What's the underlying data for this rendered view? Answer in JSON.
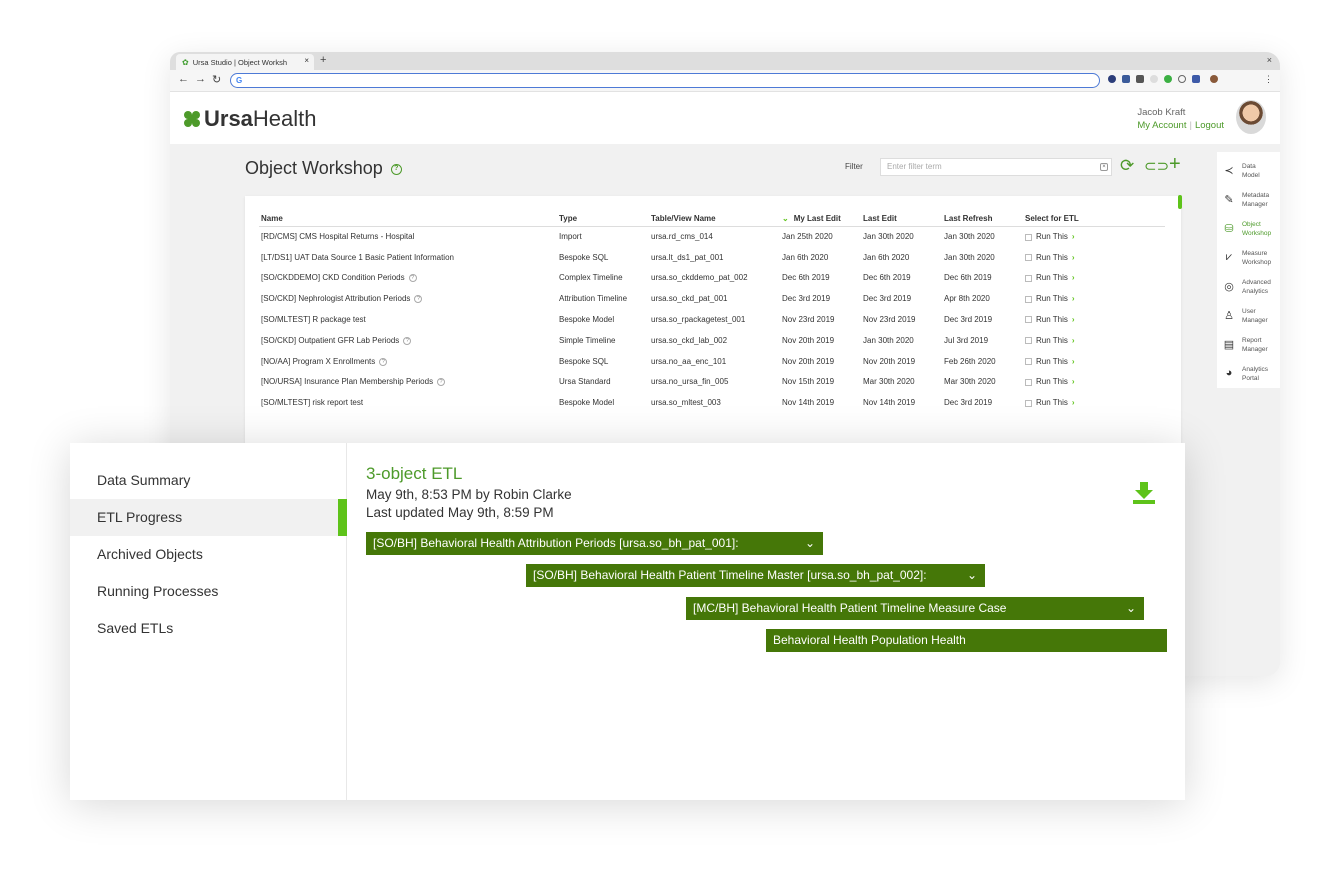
{
  "browser": {
    "tab_title": "Ursa Studio | Object Worksh",
    "new_tab": "+",
    "tab_close": "×",
    "window_close": "×",
    "omnibox_text": "G"
  },
  "header": {
    "logo_bold": "Ursa",
    "logo_light": "Health",
    "user_name": "Jacob Kraft",
    "my_account": "My Account",
    "logout": "Logout"
  },
  "workshop": {
    "title": "Object Workshop",
    "filter_label": "Filter",
    "filter_placeholder": "Enter filter term",
    "columns": [
      "Name",
      "Type",
      "Table/View Name",
      "My Last Edit",
      "Last Edit",
      "Last Refresh",
      "Select for ETL"
    ],
    "run_label": "Run This",
    "rows": [
      {
        "name": "[RD/CMS] CMS Hospital Returns - Hospital",
        "help": false,
        "type": "Import",
        "table": "ursa.rd_cms_014",
        "my_last_edit": "Jan 25th 2020",
        "last_edit": "Jan 30th 2020",
        "last_refresh": "Jan 30th 2020"
      },
      {
        "name": "[LT/DS1] UAT Data Source 1 Basic Patient Information",
        "help": false,
        "type": "Bespoke SQL",
        "table": "ursa.lt_ds1_pat_001",
        "my_last_edit": "Jan 6th 2020",
        "last_edit": "Jan 6th 2020",
        "last_refresh": "Jan 30th 2020"
      },
      {
        "name": "[SO/CKDDEMO] CKD Condition Periods",
        "help": true,
        "type": "Complex Timeline",
        "table": "ursa.so_ckddemo_pat_002",
        "my_last_edit": "Dec 6th 2019",
        "last_edit": "Dec 6th 2019",
        "last_refresh": "Dec 6th 2019"
      },
      {
        "name": "[SO/CKD] Nephrologist Attribution Periods",
        "help": true,
        "type": "Attribution Timeline",
        "table": "ursa.so_ckd_pat_001",
        "my_last_edit": "Dec 3rd 2019",
        "last_edit": "Dec 3rd 2019",
        "last_refresh": "Apr 8th 2020"
      },
      {
        "name": "[SO/MLTEST] R package test",
        "help": false,
        "type": "Bespoke Model",
        "table": "ursa.so_rpackagetest_001",
        "my_last_edit": "Nov 23rd 2019",
        "last_edit": "Nov 23rd 2019",
        "last_refresh": "Dec 3rd 2019"
      },
      {
        "name": "[SO/CKD] Outpatient GFR Lab Periods",
        "help": true,
        "type": "Simple Timeline",
        "table": "ursa.so_ckd_lab_002",
        "my_last_edit": "Nov 20th 2019",
        "last_edit": "Jan 30th 2020",
        "last_refresh": "Jul 3rd 2019"
      },
      {
        "name": "[NO/AA] Program X Enrollments",
        "help": true,
        "type": "Bespoke SQL",
        "table": "ursa.no_aa_enc_101",
        "my_last_edit": "Nov 20th 2019",
        "last_edit": "Nov 20th 2019",
        "last_refresh": "Feb 26th 2020"
      },
      {
        "name": "[NO/URSA] Insurance Plan Membership Periods",
        "help": true,
        "type": "Ursa Standard",
        "table": "ursa.no_ursa_fin_005",
        "my_last_edit": "Nov 15th 2019",
        "last_edit": "Mar 30th 2020",
        "last_refresh": "Mar 30th 2020"
      },
      {
        "name": "[SO/MLTEST] risk report test",
        "help": false,
        "type": "Bespoke Model",
        "table": "ursa.so_mltest_003",
        "my_last_edit": "Nov 14th 2019",
        "last_edit": "Nov 14th 2019",
        "last_refresh": "Dec 3rd 2019"
      }
    ]
  },
  "side_menu": [
    {
      "line1": "Data",
      "line2": "Model",
      "icon": "share-icon",
      "glyph": "≺",
      "active": false
    },
    {
      "line1": "Metadata",
      "line2": "Manager",
      "icon": "edit-icon",
      "glyph": "✎",
      "active": false
    },
    {
      "line1": "Object",
      "line2": "Workshop",
      "icon": "database-gear-icon",
      "glyph": "⛁",
      "active": true
    },
    {
      "line1": "Measure",
      "line2": "Workshop",
      "icon": "chart-person-icon",
      "glyph": "⩗",
      "active": false
    },
    {
      "line1": "Advanced",
      "line2": "Analytics",
      "icon": "analytics-icon",
      "glyph": "◎",
      "active": false
    },
    {
      "line1": "User",
      "line2": "Manager",
      "icon": "user-add-icon",
      "glyph": "♙",
      "active": false
    },
    {
      "line1": "Report",
      "line2": "Manager",
      "icon": "report-icon",
      "glyph": "▤",
      "active": false
    },
    {
      "line1": "Analytics",
      "line2": "Portal",
      "icon": "pie-chart-icon",
      "glyph": "◕",
      "active": false
    }
  ],
  "etl_panel": {
    "nav": [
      "Data Summary",
      "ETL Progress",
      "Archived Objects",
      "Running Processes",
      "Saved ETLs"
    ],
    "active_nav": "ETL Progress",
    "title": "3-object ETL",
    "created": "May 9th, 8:53 PM by Robin Clarke",
    "updated": "Last updated May 9th, 8:59 PM",
    "bars": [
      {
        "label": "[SO/BH] Behavioral Health Attribution Periods [ursa.so_bh_pat_001]:",
        "caret": true
      },
      {
        "label": "[SO/BH] Behavioral Health Patient Timeline Master [ursa.so_bh_pat_002]:",
        "caret": true
      },
      {
        "label": "[MC/BH] Behavioral Health Patient Timeline Measure Case",
        "caret": true
      },
      {
        "label": "Behavioral Health Population Health",
        "caret": false
      }
    ]
  },
  "colors": {
    "brand_green": "#4d9a2a",
    "accent_green": "#5ec31a",
    "bar_green": "#457708"
  }
}
